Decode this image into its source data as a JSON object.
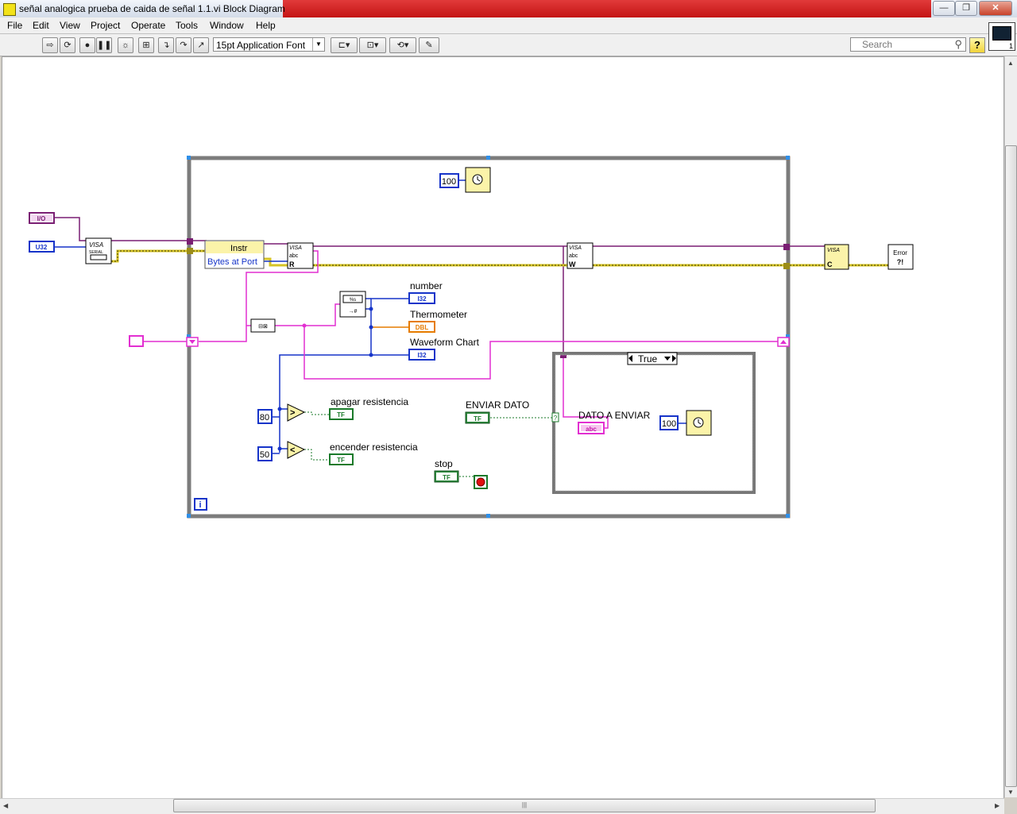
{
  "window": {
    "title": "señal analogica prueba de caida de señal 1.1.vi Block Diagram",
    "buttons": [
      "—",
      "❐",
      "✕"
    ]
  },
  "menu": [
    "File",
    "Edit",
    "View",
    "Project",
    "Operate",
    "Tools",
    "Window",
    "Help"
  ],
  "toolbar": {
    "font": "15pt Application Font",
    "search_placeholder": "Search",
    "help": "?"
  },
  "vi_icon_digit": "1",
  "diagram": {
    "io_const": "I/O",
    "u32_const": "U32",
    "visa_serial": "VISA",
    "visa_serial_sub": "SERIAL",
    "property_node_class": "Instr",
    "property_node_prop": "Bytes at Port",
    "visa_read": "VISA",
    "visa_read_mode": "R",
    "visa_write": "VISA",
    "visa_write_mode": "W",
    "visa_close": "VISA",
    "visa_close_mode": "C",
    "error_handler": "Error",
    "wait_top_value": "100",
    "wait_case_value": "100",
    "number_label": "number",
    "number_type": "I32",
    "thermometer_label": "Thermometer",
    "thermometer_type": "DBL",
    "waveform_label": "Waveform Chart",
    "waveform_type": "I32",
    "const_80": "80",
    "const_50": "50",
    "gt_symbol": ">",
    "lt_symbol": "<",
    "apagar_label": "apagar resistencia",
    "encender_label": "encender resistencia",
    "bool_type": "TF",
    "enviar_label": "ENVIAR DATO",
    "stop_label": "stop",
    "case_selector": "True",
    "dato_label": "DATO A ENVIAR",
    "dato_type": "abc",
    "loop_iteration": "i"
  },
  "colors": {
    "visa_wire": "#7a1e73",
    "string_wire": "#e22fd1",
    "int_wire": "#1634c9",
    "error_wire": "#d6c324",
    "bool_wire": "#1a7a2a",
    "loop_frame": "#7c7c7c",
    "titlebar_red": "#d02020"
  }
}
